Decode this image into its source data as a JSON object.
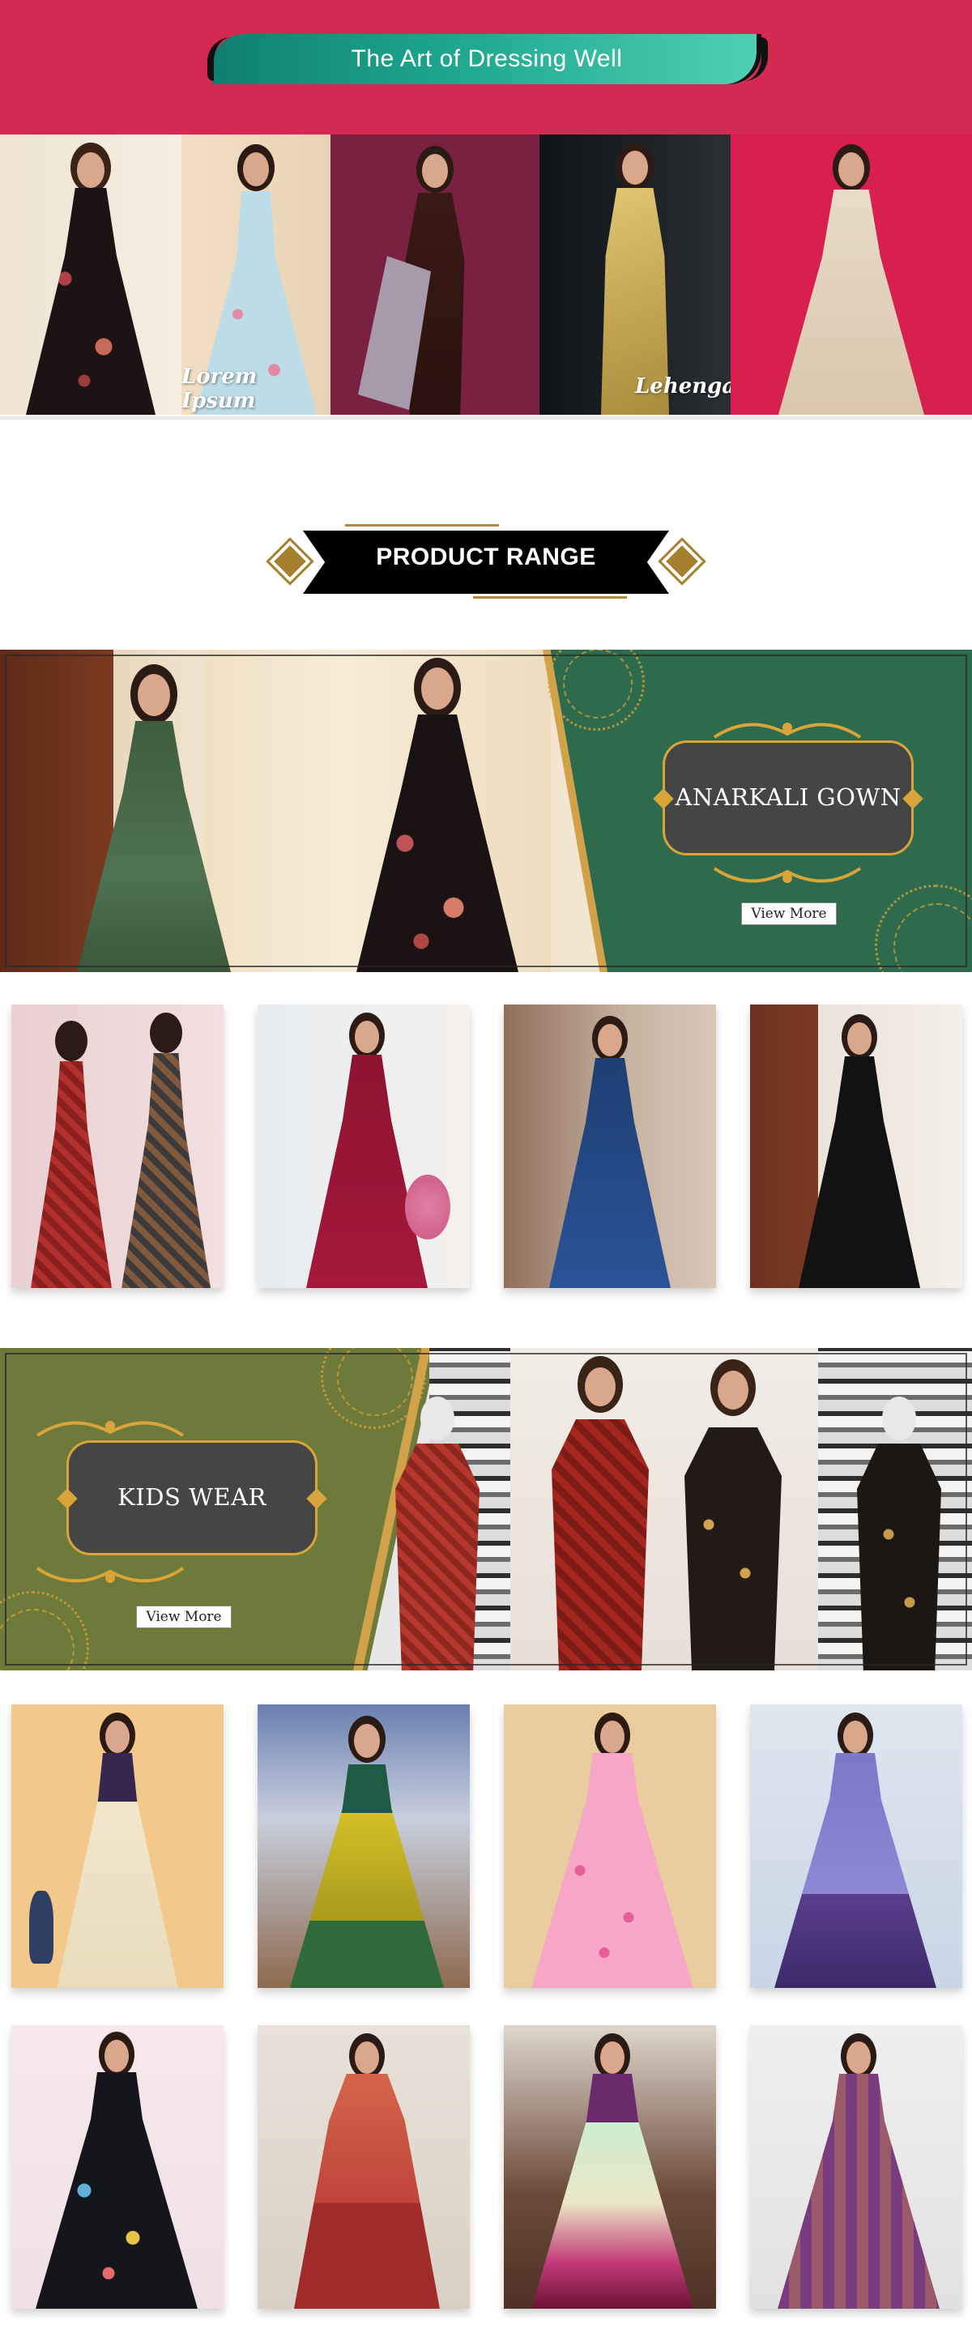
{
  "header": {
    "title": "The Art of Dressing Well",
    "brand_color": "#d42a52"
  },
  "hero": {
    "captions": [
      "Lorem Ipsum",
      "Lehenga Collection"
    ]
  },
  "product_range": {
    "heading": "PRODUCT RANGE"
  },
  "anarkali": {
    "label": "ANARKALI GOWN",
    "button": "View More",
    "panel_color": "#2e6b4d"
  },
  "kids": {
    "label": "KIDS WEAR",
    "button": "View More",
    "panel_color": "#6e7a3a"
  },
  "icons": [
    "ornament-scroll-icon",
    "diamond-icon",
    "mandala-icon"
  ]
}
